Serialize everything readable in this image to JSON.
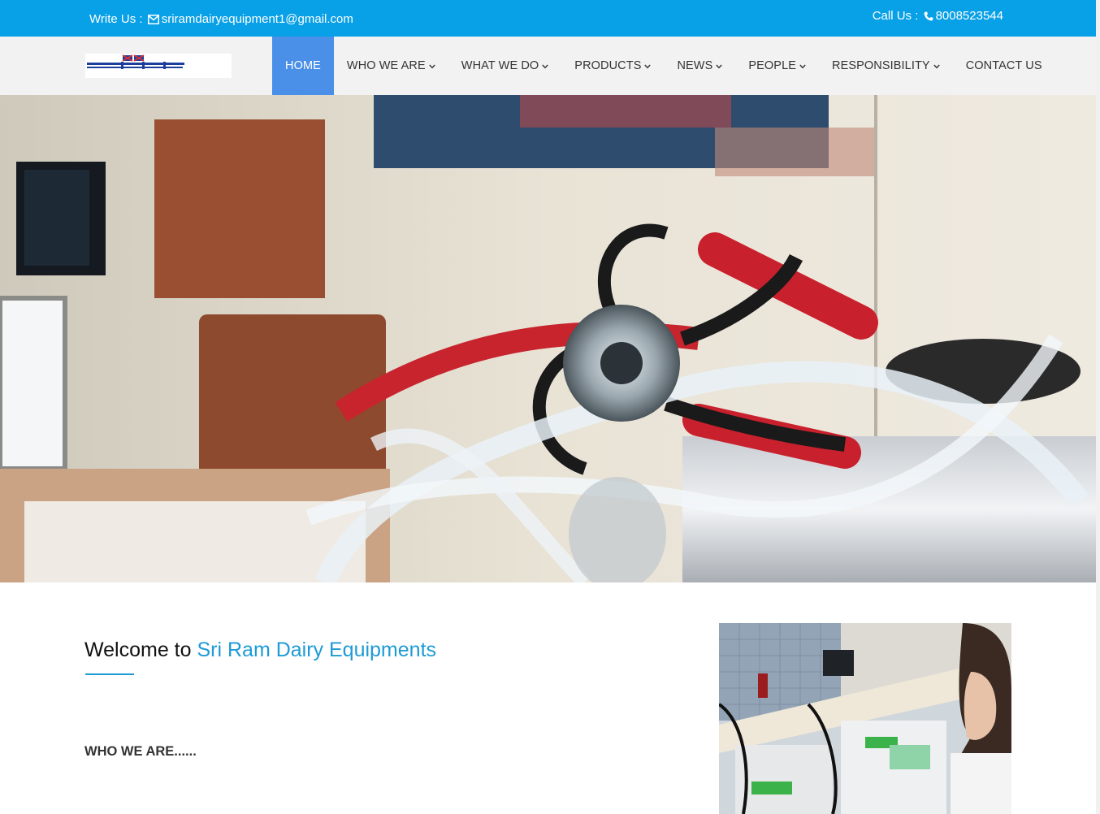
{
  "topbar": {
    "write_label": "Write Us :",
    "email": "sriramdairyequipment1@gmail.com",
    "call_label": "Call Us :",
    "phone": "8008523544",
    "mail_icon": "envelope-icon",
    "phone_icon": "phone-icon",
    "bg_color": "#08a0e6"
  },
  "brand": {
    "logo_text": "SRI RAM"
  },
  "nav": {
    "items": [
      {
        "label": "HOME",
        "active": true
      },
      {
        "label": "WHO WE ARE"
      },
      {
        "label": "WHAT WE DO"
      },
      {
        "label": "PRODUCTS"
      },
      {
        "label": "NEWS"
      },
      {
        "label": "PEOPLE"
      },
      {
        "label": "RESPONSIBILITY"
      },
      {
        "label": "CONTACT US"
      }
    ],
    "active_color": "#4a8fe8"
  },
  "welcome": {
    "prefix": "Welcome to",
    "company": "Sri Ram Dairy Equipments",
    "accent_color": "#1e9ad6"
  },
  "sections": {
    "who_we_are_heading": "WHO WE ARE......"
  }
}
